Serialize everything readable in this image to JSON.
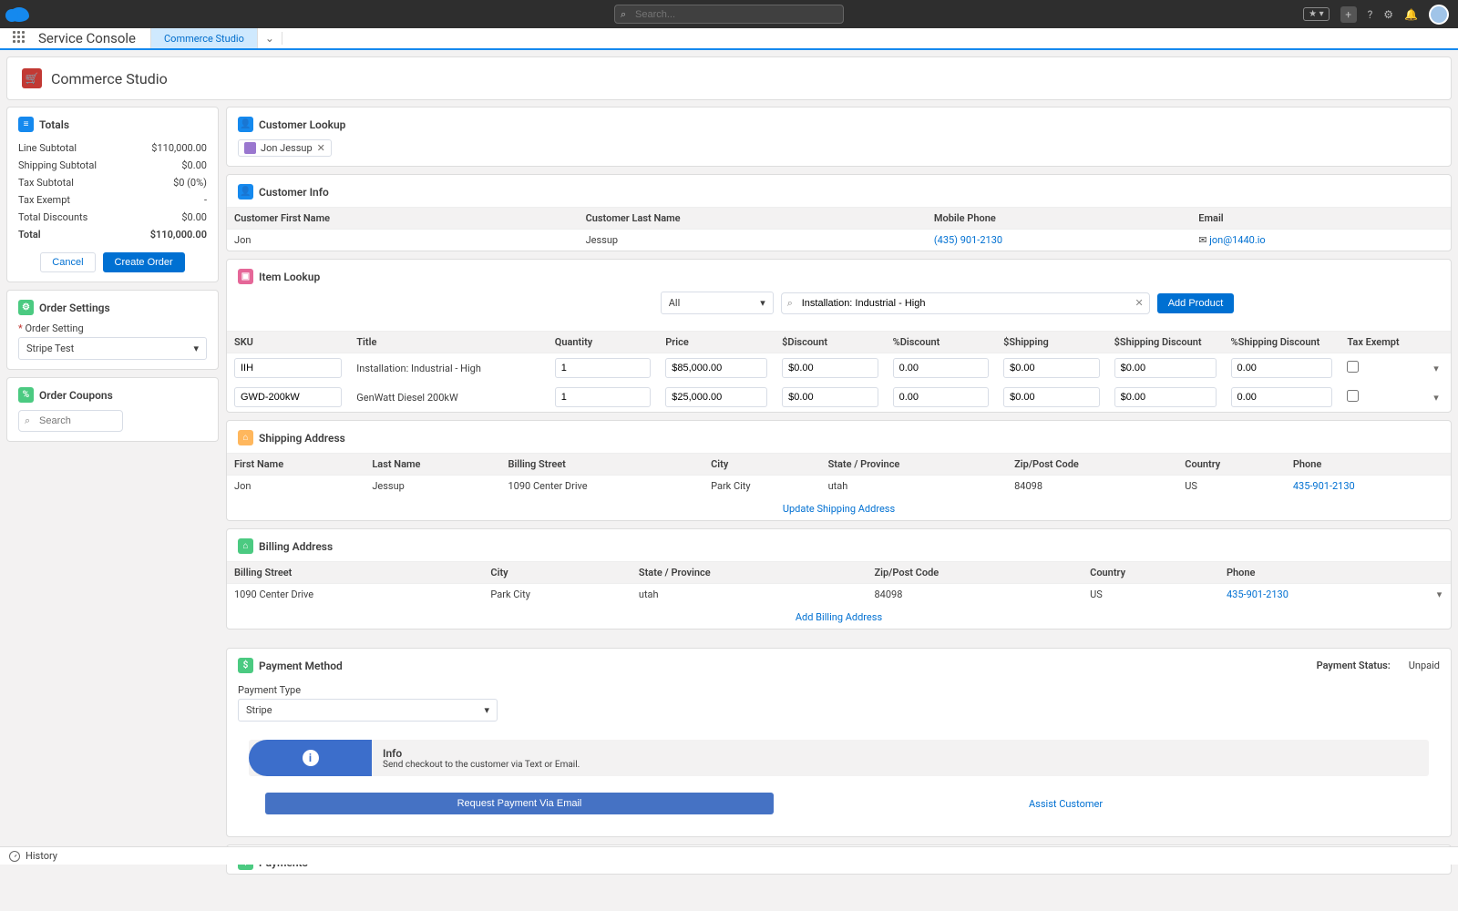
{
  "global": {
    "search_placeholder": "Search...",
    "app_name": "Service Console",
    "tab_label": "Commerce Studio",
    "page_title": "Commerce Studio",
    "history": "History"
  },
  "totals": {
    "title": "Totals",
    "rows": {
      "line_sub_label": "Line Subtotal",
      "line_sub_val": "$110,000.00",
      "ship_sub_label": "Shipping Subtotal",
      "ship_sub_val": "$0.00",
      "tax_sub_label": "Tax Subtotal",
      "tax_sub_val": "$0 (0%)",
      "tax_ex_label": "Tax Exempt",
      "tax_ex_val": "-",
      "disc_label": "Total Discounts",
      "disc_val": "$0.00",
      "total_label": "Total",
      "total_val": "$110,000.00"
    },
    "cancel": "Cancel",
    "create": "Create Order"
  },
  "settings": {
    "title": "Order Settings",
    "label": "Order Setting",
    "value": "Stripe Test"
  },
  "coupons": {
    "title": "Order Coupons",
    "placeholder": "Search"
  },
  "customer_lookup": {
    "title": "Customer Lookup",
    "chip": "Jon Jessup"
  },
  "customer_info": {
    "title": "Customer Info",
    "headers": {
      "first": "Customer First Name",
      "last": "Customer Last Name",
      "phone": "Mobile Phone",
      "email": "Email"
    },
    "row": {
      "first": "Jon",
      "last": "Jessup",
      "phone": "(435) 901-2130",
      "email": "jon@1440.io"
    }
  },
  "item_lookup": {
    "title": "Item Lookup",
    "filter": "All",
    "search_value": "Installation: Industrial - High",
    "add": "Add Product",
    "headers": {
      "sku": "SKU",
      "title": "Title",
      "qty": "Quantity",
      "price": "Price",
      "disc": "$Discount",
      "pdisc": "%Discount",
      "ship": "$Shipping",
      "shipd": "$Shipping Discount",
      "pshipd": "%Shipping Discount",
      "tax": "Tax Exempt"
    },
    "rows": [
      {
        "sku": "IIH",
        "title": "Installation: Industrial - High",
        "qty": "1",
        "price": "$85,000.00",
        "disc": "$0.00",
        "pdisc": "0.00",
        "ship": "$0.00",
        "shipd": "$0.00",
        "pshipd": "0.00"
      },
      {
        "sku": "GWD-200kW",
        "title": "GenWatt Diesel 200kW",
        "qty": "1",
        "price": "$25,000.00",
        "disc": "$0.00",
        "pdisc": "0.00",
        "ship": "$0.00",
        "shipd": "$0.00",
        "pshipd": "0.00"
      }
    ]
  },
  "shipping": {
    "title": "Shipping Address",
    "headers": {
      "first": "First Name",
      "last": "Last Name",
      "street": "Billing Street",
      "city": "City",
      "state": "State / Province",
      "zip": "Zip/Post Code",
      "country": "Country",
      "phone": "Phone"
    },
    "row": {
      "first": "Jon",
      "last": "Jessup",
      "street": "1090 Center Drive",
      "city": "Park City",
      "state": "utah",
      "zip": "84098",
      "country": "US",
      "phone": "435-901-2130"
    },
    "update": "Update Shipping Address"
  },
  "billing": {
    "title": "Billing Address",
    "headers": {
      "street": "Billing Street",
      "city": "City",
      "state": "State / Province",
      "zip": "Zip/Post Code",
      "country": "Country",
      "phone": "Phone"
    },
    "row": {
      "street": "1090 Center Drive",
      "city": "Park City",
      "state": "utah",
      "zip": "84098",
      "country": "US",
      "phone": "435-901-2130"
    },
    "add": "Add Billing Address"
  },
  "payment": {
    "title": "Payment Method",
    "status_label": "Payment Status:",
    "status_value": "Unpaid",
    "type_label": "Payment Type",
    "type_value": "Stripe",
    "info_title": "Info",
    "info_sub": "Send checkout to the customer via Text or Email.",
    "request_btn": "Request Payment Via Email",
    "assist": "Assist Customer"
  },
  "payments": {
    "title": "Payments"
  }
}
